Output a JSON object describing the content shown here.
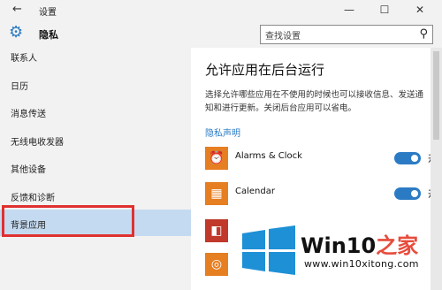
{
  "window": {
    "title": "设置",
    "minimize": "—",
    "maximize": "☐",
    "close": "✕"
  },
  "header": {
    "section_title": "隐私",
    "search_placeholder": "查找设置"
  },
  "sidebar": {
    "items": [
      {
        "label": "联系人"
      },
      {
        "label": "日历"
      },
      {
        "label": "消息传送"
      },
      {
        "label": "无线电收发器"
      },
      {
        "label": "其他设备"
      },
      {
        "label": "反馈和诊断"
      },
      {
        "label": "背景应用",
        "selected": true
      }
    ]
  },
  "main": {
    "title": "允许应用在后台运行",
    "description": "选择允许哪些应用在不使用的时候也可以接收信息、发送通知和进行更新。关闭后台应用可以省电。",
    "privacy_link": "隐私声明",
    "apps": [
      {
        "name": "Alarms & Clock",
        "icon": "alarm-clock-icon",
        "toggle": "开",
        "on": true
      },
      {
        "name": "Calendar",
        "icon": "calendar-icon",
        "toggle": "开",
        "on": true
      },
      {
        "name": "",
        "icon": "office-icon",
        "toggle": "",
        "on": null
      },
      {
        "name": "",
        "icon": "groove-music-icon",
        "toggle": "",
        "on": null
      }
    ]
  },
  "watermark": {
    "brand_prefix": "Win10",
    "brand_suffix": "之家",
    "url": "www.win10xitong.com"
  },
  "colors": {
    "accent": "#2b7bc4",
    "app_tile": "#e67e22",
    "selected_bg": "#c4daf0",
    "highlight": "#e03030"
  }
}
